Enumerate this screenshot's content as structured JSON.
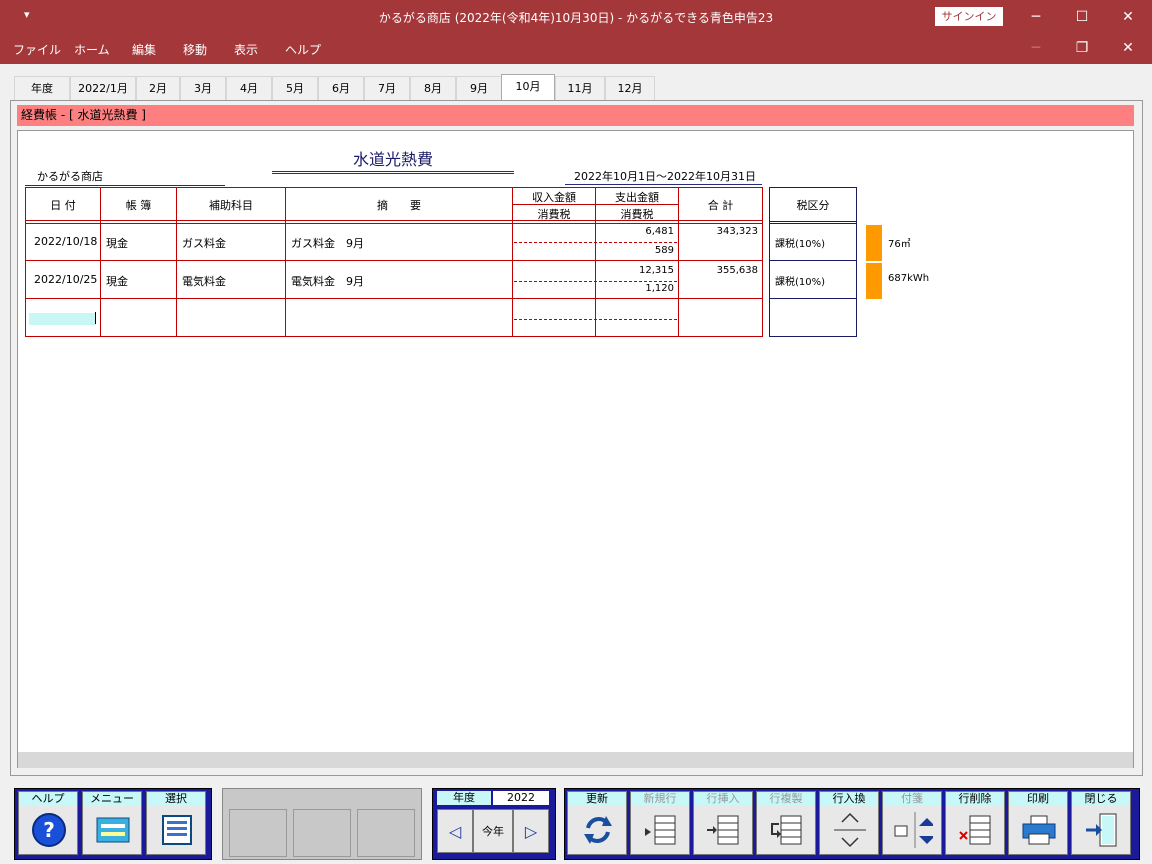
{
  "window": {
    "quick_access": "▾",
    "title": "かるがる商店 (2022年(令和4年)10月30日)  -  かるがるできる青色申告23",
    "signin": "サインイン",
    "minimize": "─",
    "maximize": "☐",
    "close": "✕",
    "doc_minimize": "─",
    "doc_restore": "❐",
    "doc_close": "✕"
  },
  "menu": [
    "ファイル",
    "ホーム",
    "編集",
    "移動",
    "表示",
    "ヘルプ"
  ],
  "tabs": [
    "年度",
    "2022/1月",
    "2月",
    "3月",
    "4月",
    "5月",
    "6月",
    "7月",
    "8月",
    "9月",
    "10月",
    "11月",
    "12月"
  ],
  "active_tab": "10月",
  "header_strip": "経費帳 - [ 水道光熱費 ]",
  "ledger": {
    "shop": "かるがる商店",
    "title": "水道光熱費",
    "period": "2022年10月1日～2022年10月31日",
    "columns": {
      "date": "日 付",
      "book": "帳 簿",
      "sub_account": "補助科目",
      "description": "摘　　要",
      "income": "収入金額",
      "expense": "支出金額",
      "tax": "消費税",
      "tax2": "消費税",
      "total": "合 計",
      "tax_category": "税区分"
    },
    "rows": [
      {
        "date": "2022/10/18",
        "book": "現金",
        "sub": "ガス料金",
        "desc": "ガス料金　9月",
        "expense": "6,481",
        "expense_tax": "589",
        "total": "343,323",
        "tax_cat": "課税(10%)",
        "note": "76㎥"
      },
      {
        "date": "2022/10/25",
        "book": "現金",
        "sub": "電気料金",
        "desc": "電気料金　9月",
        "expense": "12,315",
        "expense_tax": "1,120",
        "total": "355,638",
        "tax_cat": "課税(10%)",
        "note": "687kWh"
      }
    ]
  },
  "bottom": {
    "help": "ヘルプ",
    "menu": "メニュー",
    "select": "選択",
    "year_label": "年度",
    "year_value": "2022",
    "this_year": "今年",
    "update": "更新",
    "new_row": "新規行",
    "insert_row": "行挿入",
    "copy_row": "行複製",
    "swap_row": "行入換",
    "sticky": "付箋",
    "delete_row": "行削除",
    "print": "印刷",
    "close": "閉じる"
  },
  "colors": {
    "titlebar": "#a4373a",
    "header_strip": "#fd7f7f",
    "grid_red": "#c00000",
    "navy": "#1a1a66",
    "orange_marker": "#ff9900",
    "button_label_bg": "#c8f7f7",
    "toolbar_blue": "#1a1a9a"
  }
}
